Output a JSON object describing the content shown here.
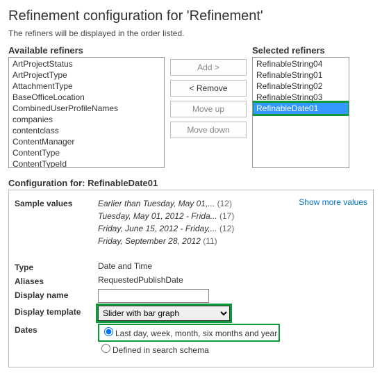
{
  "header": {
    "title": "Refinement configuration for 'Refinement'",
    "subtitle": "The refiners will be displayed in the order listed."
  },
  "available": {
    "label": "Available refiners",
    "items": [
      "ArtProjectStatus",
      "ArtProjectType",
      "AttachmentType",
      "BaseOfficeLocation",
      "CombinedUserProfileNames",
      "companies",
      "contentclass",
      "ContentManager",
      "ContentType",
      "ContentTypeId"
    ]
  },
  "buttons": {
    "add": "Add >",
    "remove": "< Remove",
    "moveup": "Move up",
    "movedown": "Move down"
  },
  "selected": {
    "label": "Selected refiners",
    "items": [
      "RefinableString04",
      "RefinableString01",
      "RefinableString02",
      "RefinableString03",
      "RefinableDate01"
    ],
    "highlight_index": 4
  },
  "config": {
    "title_prefix": "Configuration for: ",
    "title_value": "RefinableDate01",
    "sample_label": "Sample values",
    "show_more": "Show more values",
    "samples": [
      {
        "text": "Earlier than Tuesday, May 01,...",
        "count": "(12)"
      },
      {
        "text": "Tuesday, May 01, 2012 - Frida...",
        "count": "(17)"
      },
      {
        "text": "Friday, June 15, 2012 - Friday,...",
        "count": "(12)"
      },
      {
        "text": "Friday, September 28, 2012",
        "count": "(11)"
      }
    ],
    "type_label": "Type",
    "type_value": "Date and Time",
    "aliases_label": "Aliases",
    "aliases_value": "RequestedPublishDate",
    "displayname_label": "Display name",
    "displayname_value": "",
    "template_label": "Display template",
    "template_value": "Slider with bar graph",
    "dates_label": "Dates",
    "dates_opt1": "Last day, week, month, six months and year",
    "dates_opt2": "Defined in search schema",
    "dates_selected": 0
  }
}
